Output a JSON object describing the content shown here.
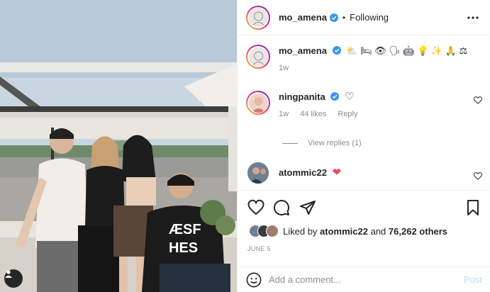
{
  "photo": {
    "alt": "Group photo by the river",
    "tag_icon": "user-tag-icon"
  },
  "header": {
    "username": "mo_amena",
    "separator": "•",
    "follow_status": "Following",
    "more_icon": "more-horizontal-icon"
  },
  "caption": {
    "username": "mo_amena",
    "emojis": "⛅ 🛏 👁 🗣 🤖 💡 ✨ 🙏 ⚖",
    "time": "1w"
  },
  "comments": [
    {
      "username": "ningpanita",
      "text": "♡",
      "time": "1w",
      "likes": "44 likes",
      "reply": "Reply"
    },
    {
      "username": "atommic22",
      "text": "❤"
    }
  ],
  "view_replies": "View replies (1)",
  "actions": {
    "like_icon": "heart-icon",
    "comment_icon": "comment-icon",
    "share_icon": "share-icon",
    "save_icon": "bookmark-icon"
  },
  "likes": {
    "prefix": "Liked by",
    "user": "atommic22",
    "middle": "and",
    "others": "76,262 others"
  },
  "date": "JUNE 5",
  "add_comment": {
    "placeholder": "Add a comment...",
    "post": "Post",
    "emoji_icon": "emoji-icon"
  },
  "colors": {
    "verified": "#3897f0",
    "link_post": "#b2dffc",
    "heart_red": "#ed4956"
  }
}
